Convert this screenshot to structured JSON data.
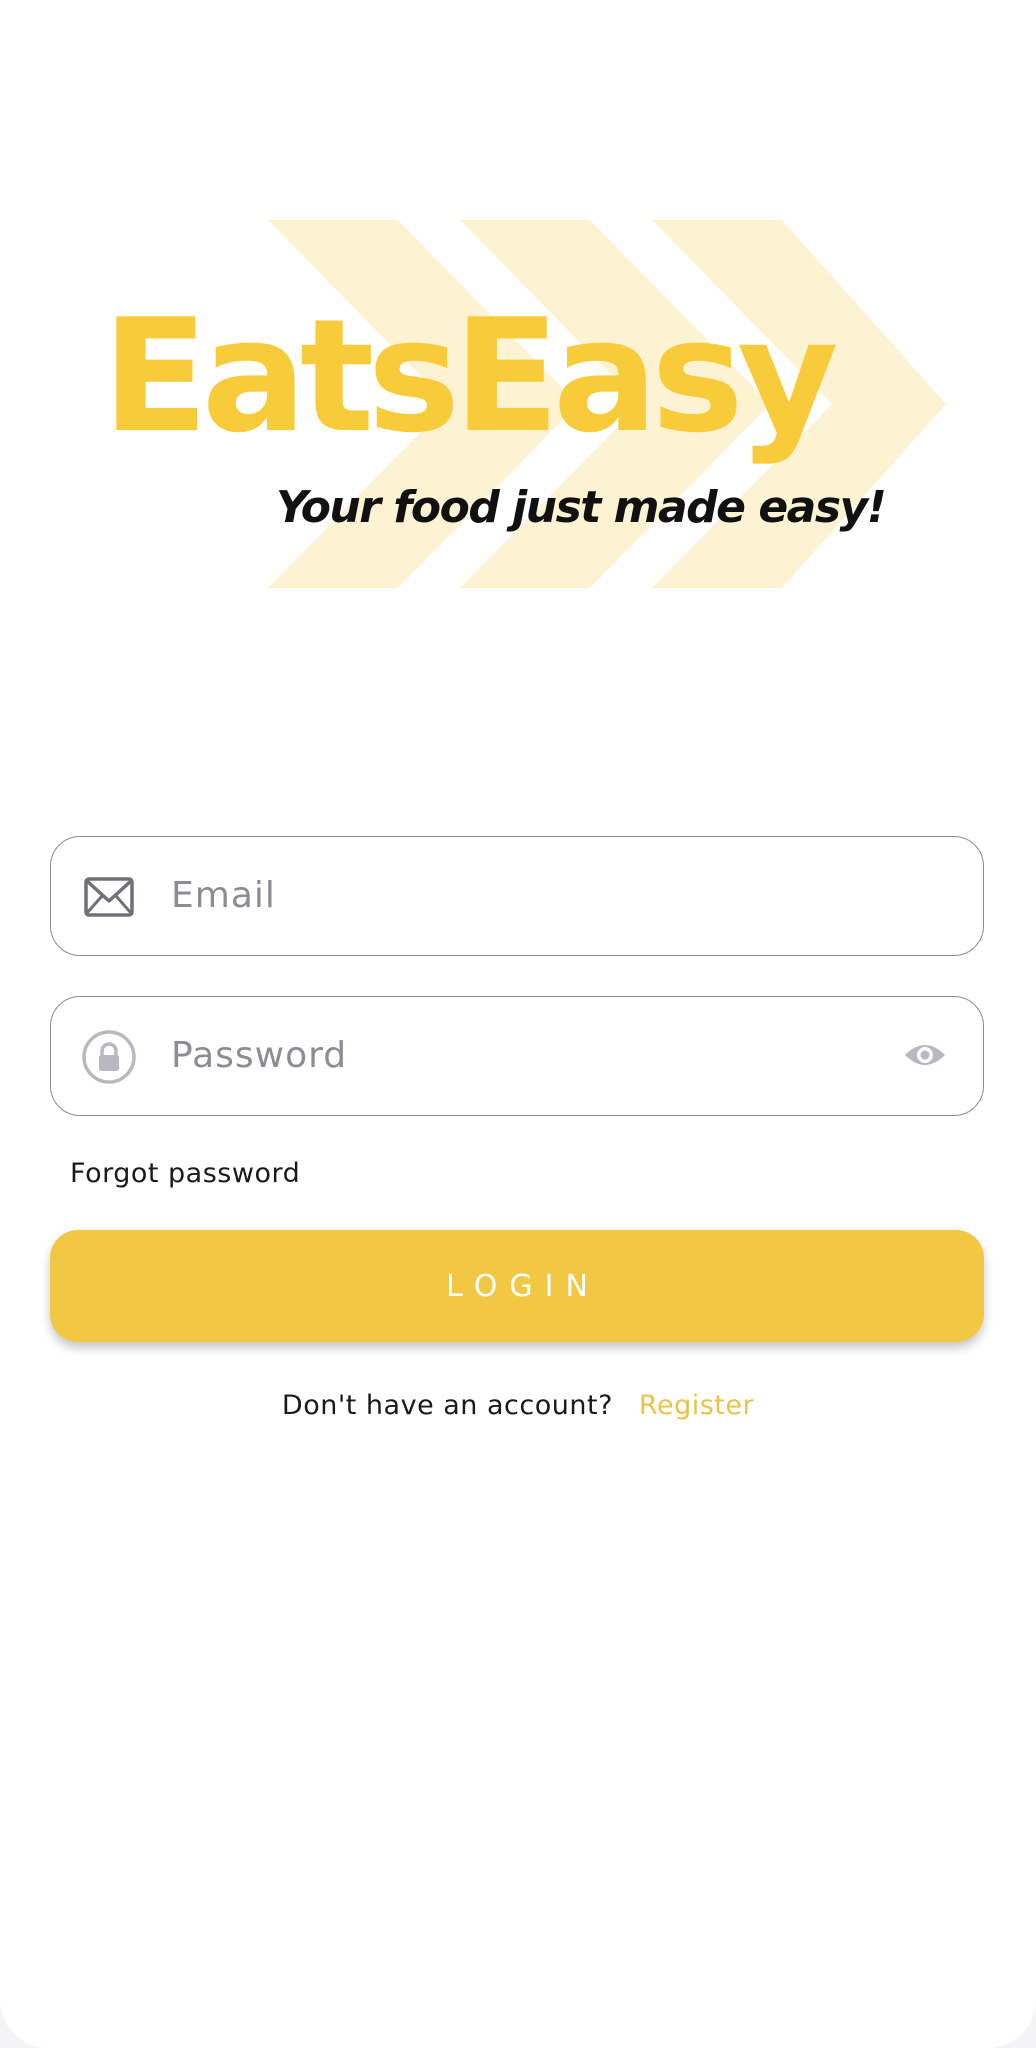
{
  "brand": {
    "name": "EatsEasy",
    "tagline": "Your food just made easy!",
    "colors": {
      "primary": "#f8cb3a",
      "chevron": "#fdf3d3",
      "button": "#f2c744",
      "link": "#e9c34a"
    }
  },
  "form": {
    "email": {
      "placeholder": "Email",
      "value": "",
      "icon": "envelope-icon"
    },
    "password": {
      "placeholder": "Password",
      "value": "",
      "icon": "lock-icon",
      "toggle_icon": "eye-icon"
    },
    "forgot_label": "Forgot password",
    "login_label": "LOGIN"
  },
  "footer": {
    "prompt": "Don't have an account?",
    "register_label": "Register"
  }
}
